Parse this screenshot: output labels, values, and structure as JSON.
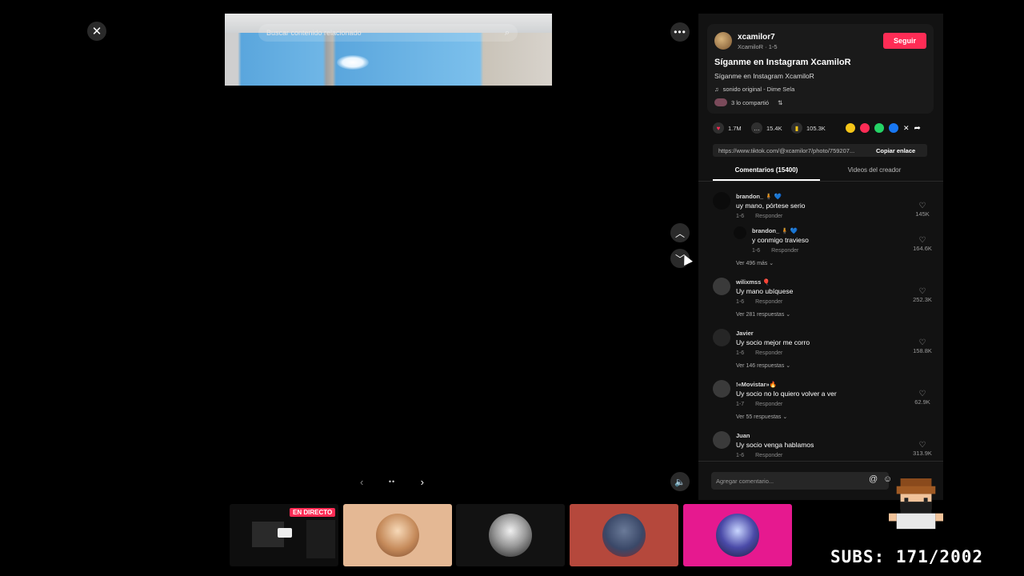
{
  "viewer": {
    "search_placeholder": "Buscar contenido relacionado",
    "pager_prev": "‹",
    "pager_dots": "••",
    "pager_next": "›"
  },
  "post": {
    "username": "xcamilor7",
    "handle_meta": "XcamiloR · 1-5",
    "follow_label": "Seguir",
    "title": "Síganme en Instagram XcamiloR",
    "description": "Síganme en Instagram XcamiloR",
    "sound": "sonido original - Dime Sela",
    "shared": "3 lo compartió",
    "likes": "1.7M",
    "comments_count": "15.4K",
    "saves": "105.3K",
    "link_url": "https://www.tiktok.com/@xcamilor7/photo/759207...",
    "copy_link": "Copiar enlace"
  },
  "tabs": {
    "comments": "Comentarios (15400)",
    "creator_videos": "Videos del creador"
  },
  "comments": [
    {
      "user": "brandon_ 🧍 💙",
      "text": "uy mano, pórtese serio",
      "date": "1-6",
      "reply": "Responder",
      "likes": "145K"
    },
    {
      "user": "brandon_ 🧍 💙",
      "text": "y conmigo travieso",
      "date": "1-6",
      "reply": "Responder",
      "likes": "164.6K",
      "more": "Ver 496 más"
    },
    {
      "user": "wilixmss 🎈",
      "text": "Uy mano ubíquese",
      "date": "1-6",
      "reply": "Responder",
      "likes": "252.3K",
      "more": "Ver 281 respuestas"
    },
    {
      "user": "Javier",
      "text": "Uy socio mejor me corro",
      "date": "1-6",
      "reply": "Responder",
      "likes": "158.8K",
      "more": "Ver 146 respuestas"
    },
    {
      "user": "!«Movistar»🔥",
      "text": "Uy socio no lo quiero volver a ver",
      "date": "1-7",
      "reply": "Responder",
      "likes": "62.9K",
      "more": "Ver 55 respuestas"
    },
    {
      "user": "Juan",
      "text": "Uy socio venga hablamos",
      "date": "1-6",
      "reply": "Responder",
      "likes": "313.9K"
    }
  ],
  "comment_box": {
    "placeholder": "Agregar comentario..."
  },
  "live": {
    "badge": "EN DIRECTO"
  },
  "overlay": {
    "subs": "SUBS: 171/2002"
  },
  "colors": {
    "accent": "#fe2c55",
    "panel": "#121212"
  }
}
